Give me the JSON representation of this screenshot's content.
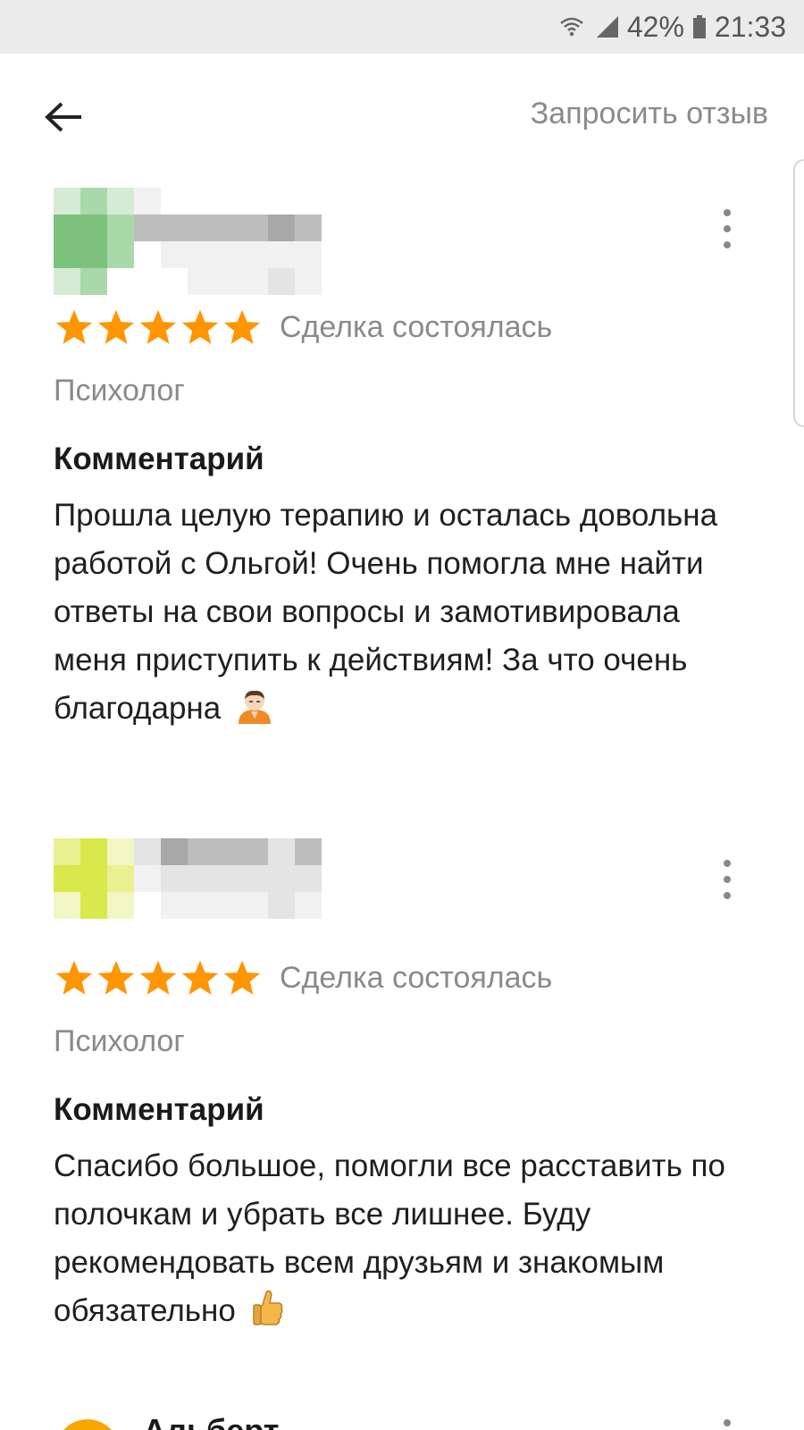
{
  "status_bar": {
    "battery": "42%",
    "time": "21:33",
    "icons": [
      "wifi-icon",
      "signal-icon",
      "battery-icon"
    ]
  },
  "header": {
    "back_icon": "arrow-left-icon",
    "request_review": "Запросить отзыв"
  },
  "reviews": [
    {
      "rating": 5,
      "deal_status": "Сделка состоялась",
      "category": "Психолог",
      "comment_title": "Комментарий",
      "comment_text": "Прошла целую терапию и осталась довольна работой с Ольгой! Очень помогла мне найти ответы на свои вопросы и замотивировала меня приступить к действиям! За что очень благодарна",
      "emoji": "pray-emoji-icon",
      "avatar_blurred": true
    },
    {
      "rating": 5,
      "deal_status": "Сделка состоялась",
      "category": "Психолог",
      "comment_title": "Комментарий",
      "comment_text": "Спасибо большое, помогли все расставить по полочкам и убрать все лишнее. Буду рекомендовать всем друзьям и знакомым обязательно",
      "emoji": "thumbs-up-icon",
      "avatar_blurred": true
    },
    {
      "author": "Альберт",
      "avatar_color": "#f7a600"
    }
  ],
  "colors": {
    "star": "#ff9500",
    "muted_text": "#8a8a8a",
    "status_bar_bg": "#ebebeb"
  }
}
